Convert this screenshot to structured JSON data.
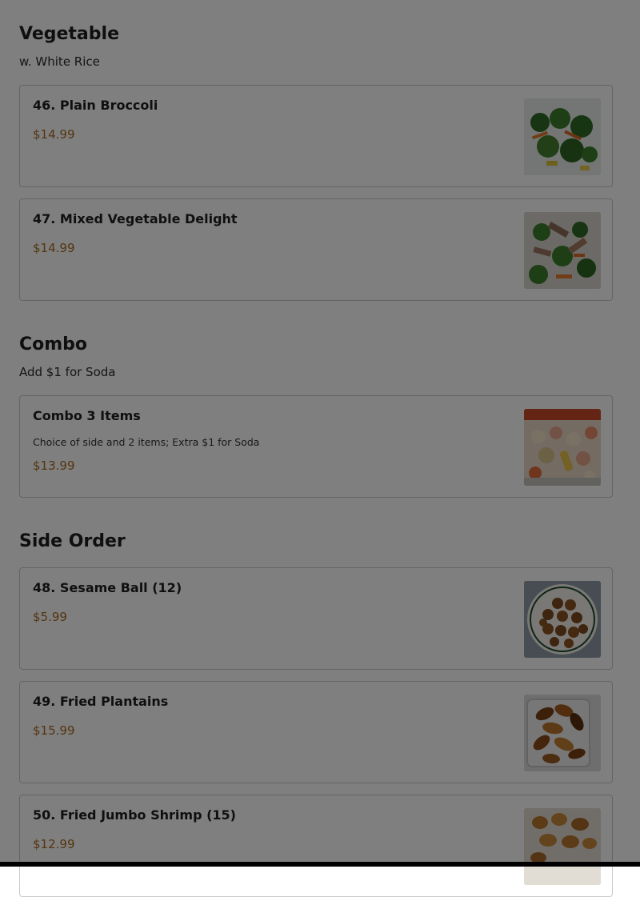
{
  "sections": [
    {
      "title": "Vegetable",
      "subtitle": "w. White Rice",
      "items": [
        {
          "name": "46. Plain Broccoli",
          "price": "$14.99"
        },
        {
          "name": "47. Mixed Vegetable Delight",
          "price": "$14.99"
        }
      ]
    },
    {
      "title": "Combo",
      "subtitle": "Add $1 for Soda",
      "items": [
        {
          "name": "Combo 3 Items",
          "description": "Choice of side and 2 items; Extra $1 for Soda",
          "price": "$13.99"
        }
      ]
    },
    {
      "title": "Side Order",
      "items": [
        {
          "name": "48. Sesame Ball (12)",
          "price": "$5.99"
        },
        {
          "name": "49. Fried Plantains",
          "price": "$15.99"
        },
        {
          "name": "50. Fried Jumbo Shrimp (15)",
          "price": "$12.99"
        }
      ]
    }
  ],
  "colors": {
    "price": "#a86a1f",
    "overlay": "rgba(0,0,0,0.5)"
  }
}
